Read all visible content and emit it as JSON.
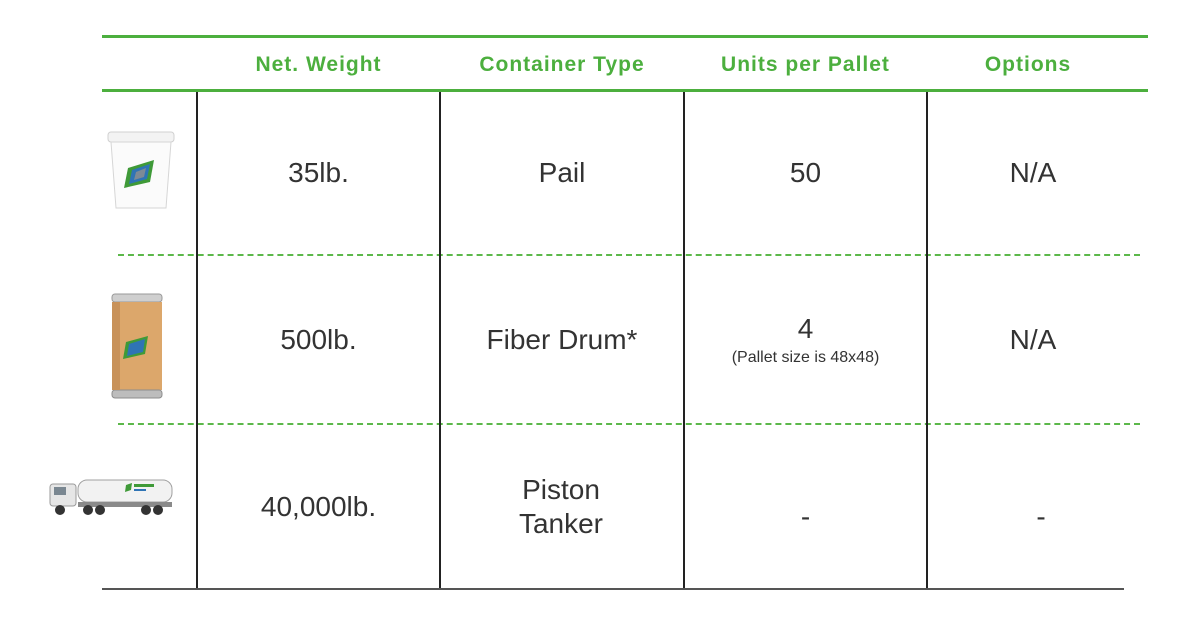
{
  "headers": [
    "Net. Weight",
    "Container Type",
    "Units per Pallet",
    "Options"
  ],
  "rows": [
    {
      "image_icon": "white-pail-icon",
      "net_weight": "35lb.",
      "container_type": "Pail",
      "units_per_pallet": "50",
      "units_note": "",
      "options": "N/A"
    },
    {
      "image_icon": "fiber-drum-icon",
      "net_weight": "500lb.",
      "container_type": "Fiber Drum*",
      "units_per_pallet": "4",
      "units_note": "(Pallet size is 48x48)",
      "options": "N/A"
    },
    {
      "image_icon": "tanker-truck-icon",
      "net_weight": "40,000lb.",
      "container_type": "Piston Tanker",
      "units_per_pallet": "-",
      "units_note": "",
      "options": "-"
    }
  ],
  "colors": {
    "accent_green": "#4caf3e",
    "text": "#333333",
    "drum": "#d9a46a",
    "logo_blue": "#2f74b5"
  }
}
